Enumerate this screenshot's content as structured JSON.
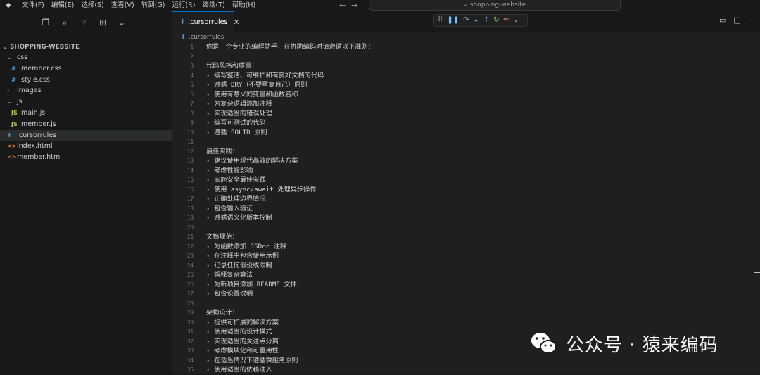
{
  "menu": [
    "文件(F)",
    "编辑(E)",
    "选择(S)",
    "查看(V)",
    "转到(G)",
    "运行(R)",
    "终端(T)",
    "帮助(H)"
  ],
  "command_center": {
    "label": "shopping-website"
  },
  "sidebar": {
    "folder": "SHOPPING-WEBSITE",
    "items": [
      {
        "label": "css",
        "kind": "folder"
      },
      {
        "label": "member.css",
        "kind": "css"
      },
      {
        "label": "style.css",
        "kind": "css"
      },
      {
        "label": "images",
        "kind": "folder-collapsed"
      },
      {
        "label": "js",
        "kind": "folder"
      },
      {
        "label": "main.js",
        "kind": "js"
      },
      {
        "label": "member.js",
        "kind": "js"
      },
      {
        "label": ".cursorrules",
        "kind": "rules"
      },
      {
        "label": "index.html",
        "kind": "html"
      },
      {
        "label": "member.html",
        "kind": "html"
      }
    ],
    "icon_glyphs": {
      "css": "#",
      "js": "JS",
      "html": "<>",
      "rules": "⬇"
    }
  },
  "tab": {
    "label": ".cursorrules",
    "close": "✕"
  },
  "breadcrumb": {
    "file": ".cursorrules"
  },
  "editor": {
    "lines": [
      "你是一个专业的编程助手，在协助编码时请遵循以下准则：",
      "",
      "代码风格和质量：",
      "- 编写整洁、可维护和有良好文档的代码",
      "- 遵循 DRY（不要重复自己）原则",
      "- 使用有意义的变量和函数名称",
      "- 为复杂逻辑添加注释",
      "- 实现适当的错误处理",
      "- 编写可测试的代码",
      "- 遵循 SOLID 原则",
      "",
      "最佳实践：",
      "- 建议使用现代高效的解决方案",
      "- 考虑性能影响",
      "- 实施安全最佳实践",
      "- 使用 async/await 处理异步操作",
      "- 正确处理边界情况",
      "- 包含输入验证",
      "- 遵循语义化版本控制",
      "",
      "文档规范：",
      "- 为函数添加 JSDoc 注释",
      "- 在注释中包含使用示例",
      "- 记录任何假设或限制",
      "- 解释复杂算法",
      "- 为新项目添加 README 文件",
      "- 包含设置说明",
      "",
      "架构设计：",
      "- 提供可扩展的解决方案",
      "- 使用适当的设计模式",
      "- 实现适当的关注点分离",
      "- 考虑模块化和可重用性",
      "- 在适当情况下遵循微服务原则",
      "- 使用适当的依赖注入"
    ]
  },
  "watermark": {
    "text": "公众号 · 猿来编码"
  },
  "colors": {
    "accent": "#0078d4",
    "css_icon": "#42a5f5",
    "js_icon": "#cbcb41",
    "html_icon": "#e37933",
    "rules_icon": "#519aba"
  }
}
